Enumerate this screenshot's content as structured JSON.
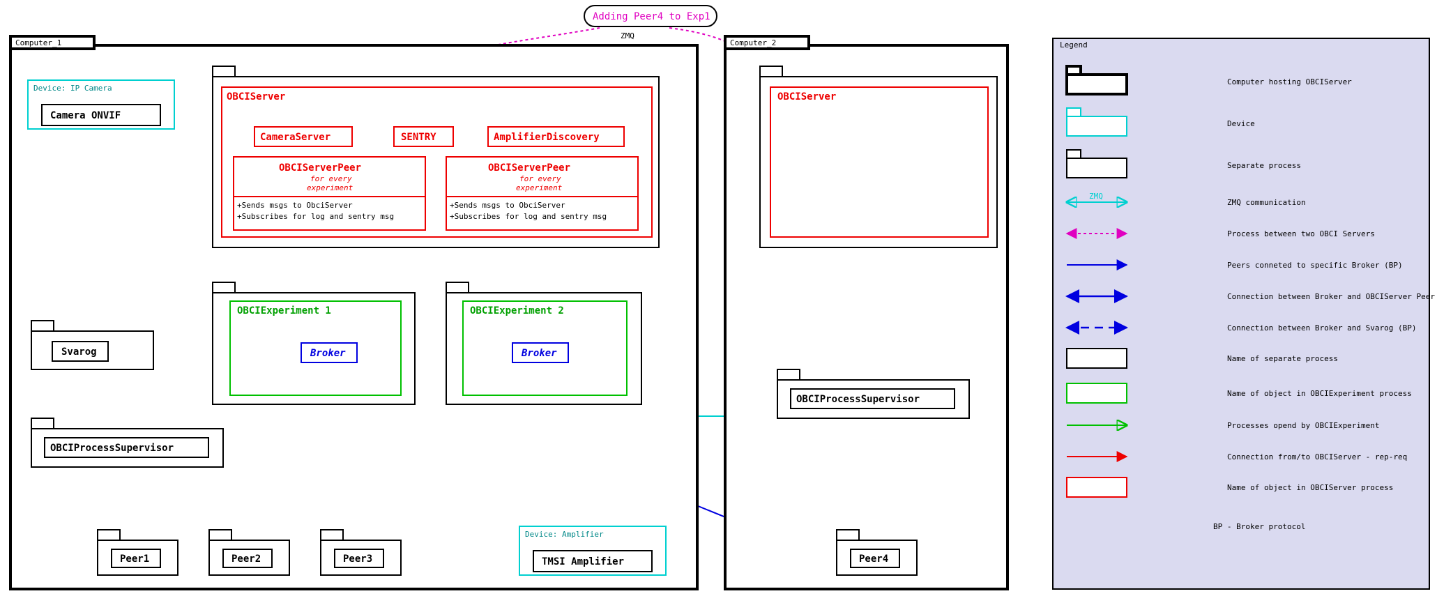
{
  "annotation": {
    "text": "Adding Peer4 to Exp1",
    "sublabel": "ZMQ"
  },
  "computers": {
    "c1": {
      "label": "Computer_1"
    },
    "c2": {
      "label": "Computer_2"
    }
  },
  "devices": {
    "ipcam": {
      "group": "Device: IP Camera",
      "label": "Camera ONVIF"
    },
    "amp": {
      "group": "Device: Amplifier",
      "label": "TMSI Amplifier"
    }
  },
  "obciserver1": {
    "title": "OBCIServer",
    "cameraServer": "CameraServer",
    "sentry": "SENTRY",
    "ampDiscovery": "AmplifierDiscovery",
    "serverPeer": {
      "title": "OBCIServerPeer",
      "sub1": "for every",
      "sub2": "experiment",
      "line1": "+Sends msgs to ObciServer",
      "line2": "+Subscribes for log and sentry msg"
    }
  },
  "obciserver2": {
    "title": "OBCIServer"
  },
  "exp1": {
    "title": "OBCIExperiment 1",
    "broker": "Broker"
  },
  "exp2": {
    "title": "OBCIExperiment 2",
    "broker": "Broker"
  },
  "svarog": {
    "label": "Svarog"
  },
  "ops1": {
    "label": "OBCIProcessSupervisor"
  },
  "ops2": {
    "label": "OBCIProcessSupervisor"
  },
  "peers": {
    "p1": "Peer1",
    "p2": "Peer2",
    "p3": "Peer3",
    "p4": "Peer4"
  },
  "zmqLabel": "ZMQ",
  "legend": {
    "title": "Legend",
    "items": [
      "Computer hosting OBCIServer",
      "Device",
      "Separate process",
      "ZMQ communication",
      "Process between two OBCI Servers",
      "Peers conneted to specific Broker (BP)",
      "Connection between Broker and OBCIServer Peer (BP)",
      "Connection between Broker and Svarog (BP)",
      "Name of separate process",
      "Name of object in OBCIExperiment process",
      "Processes opend by OBCIExperiment",
      "Connection from/to OBCIServer - rep-req",
      "Name of object in OBCIServer process",
      "BP - Broker protocol"
    ],
    "zmqLabel": "ZMQ"
  }
}
